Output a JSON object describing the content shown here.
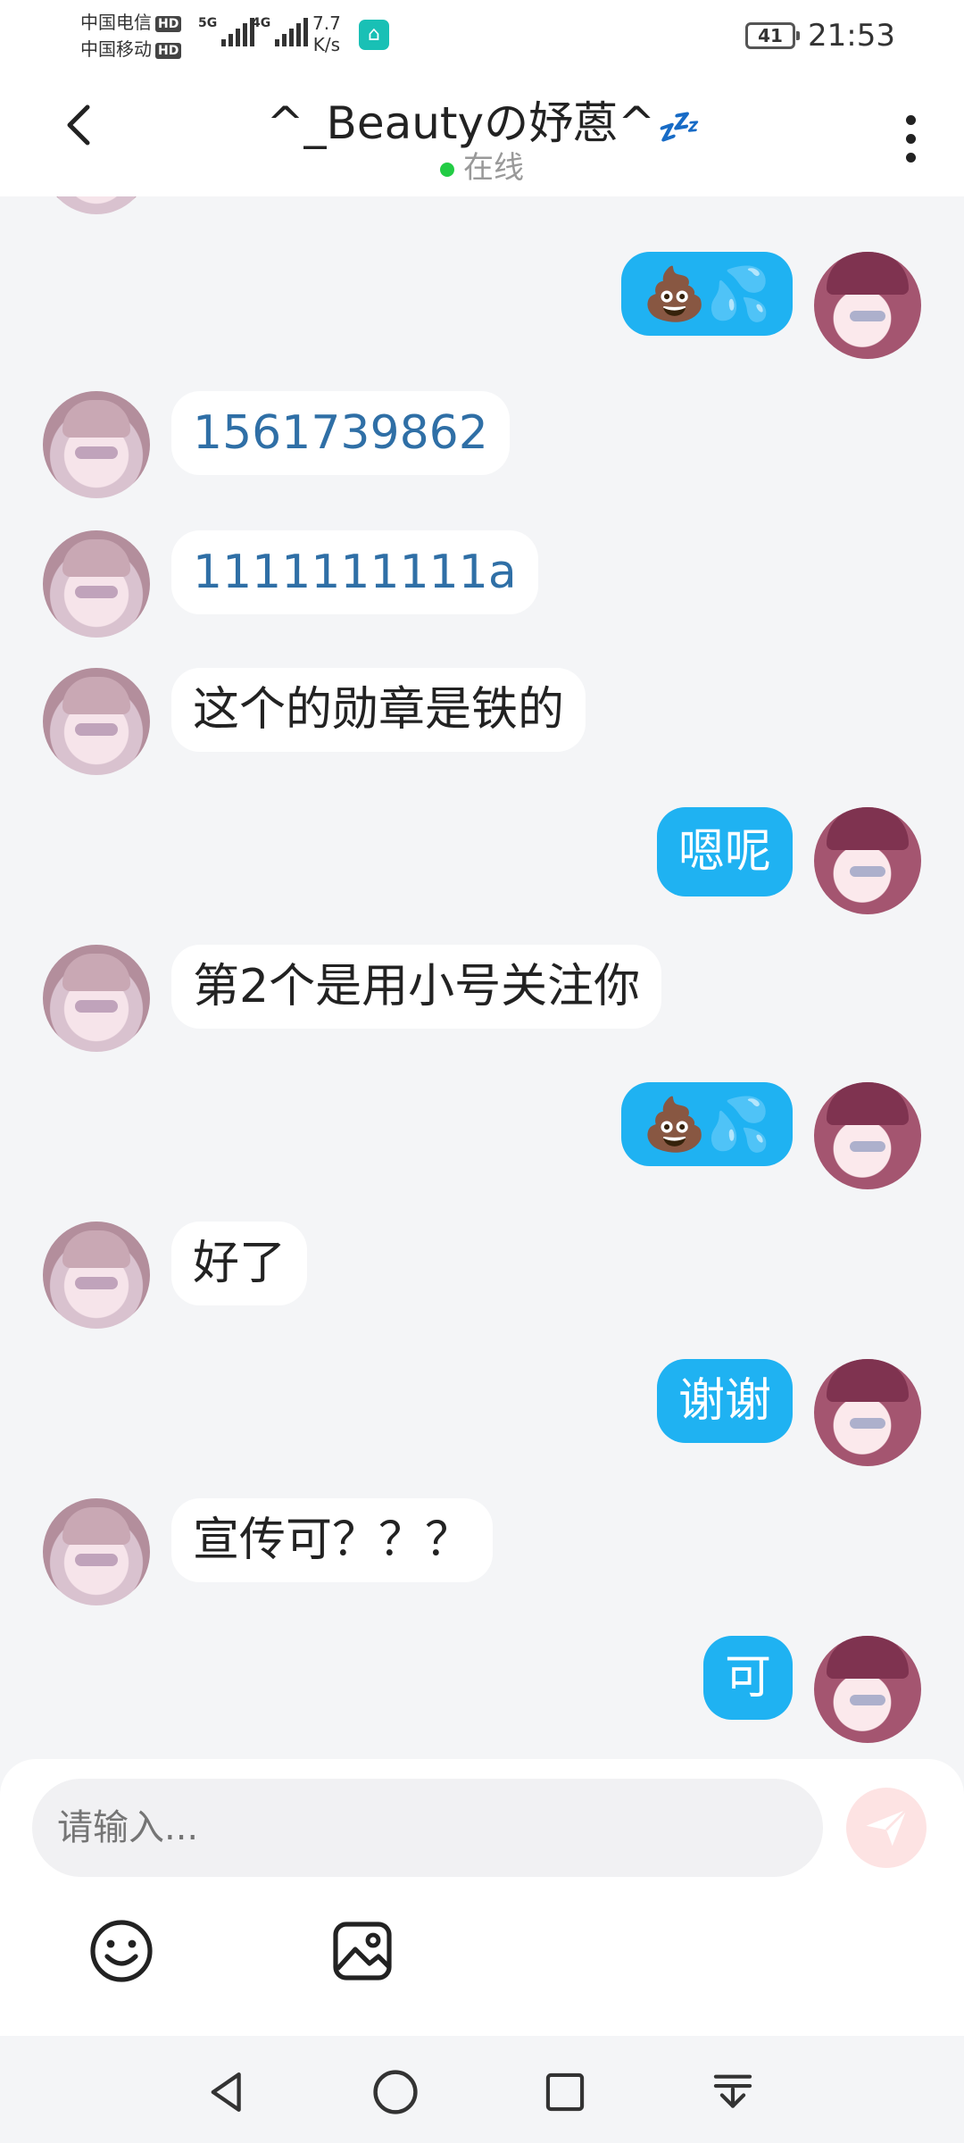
{
  "status_bar": {
    "carrier1": "中国电信",
    "carrier2": "中国移动",
    "hd": "HD",
    "sig1_label": "5G",
    "sig2_label": "4G",
    "speed_value": "7.7",
    "speed_unit": "K/s",
    "battery": "41",
    "time": "21:53"
  },
  "header": {
    "title": "^_Beautyの妤蒽^",
    "title_emoji": "💤",
    "status": "在线",
    "back_icon": "chevron-left-icon",
    "more_icon": "more-vertical-icon"
  },
  "messages": [
    {
      "from": "self",
      "text": "💩💦"
    },
    {
      "from": "other",
      "text": "1561739862",
      "style": "link"
    },
    {
      "from": "other",
      "text": "1111111111a",
      "style": "link"
    },
    {
      "from": "other",
      "text": "这个的勋章是铁的"
    },
    {
      "from": "self",
      "text": "嗯呢"
    },
    {
      "from": "other",
      "text": "第2个是用小号关注你"
    },
    {
      "from": "self",
      "text": "💩💦"
    },
    {
      "from": "other",
      "text": "好了"
    },
    {
      "from": "self",
      "text": "谢谢"
    },
    {
      "from": "other",
      "text": "宣传可？？？"
    },
    {
      "from": "self",
      "text": "可"
    }
  ],
  "input": {
    "placeholder": "请输入...",
    "send_icon": "send-icon",
    "emoji_icon": "emoji-icon",
    "image_icon": "image-icon"
  },
  "nav": {
    "back": "nav-back-icon",
    "home": "nav-home-icon",
    "recents": "nav-recents-icon",
    "dropdown": "nav-notification-icon"
  },
  "colors": {
    "self_bubble": "#1fb2f2",
    "online_dot": "#22cc44",
    "link_text": "#2f6fa6"
  }
}
